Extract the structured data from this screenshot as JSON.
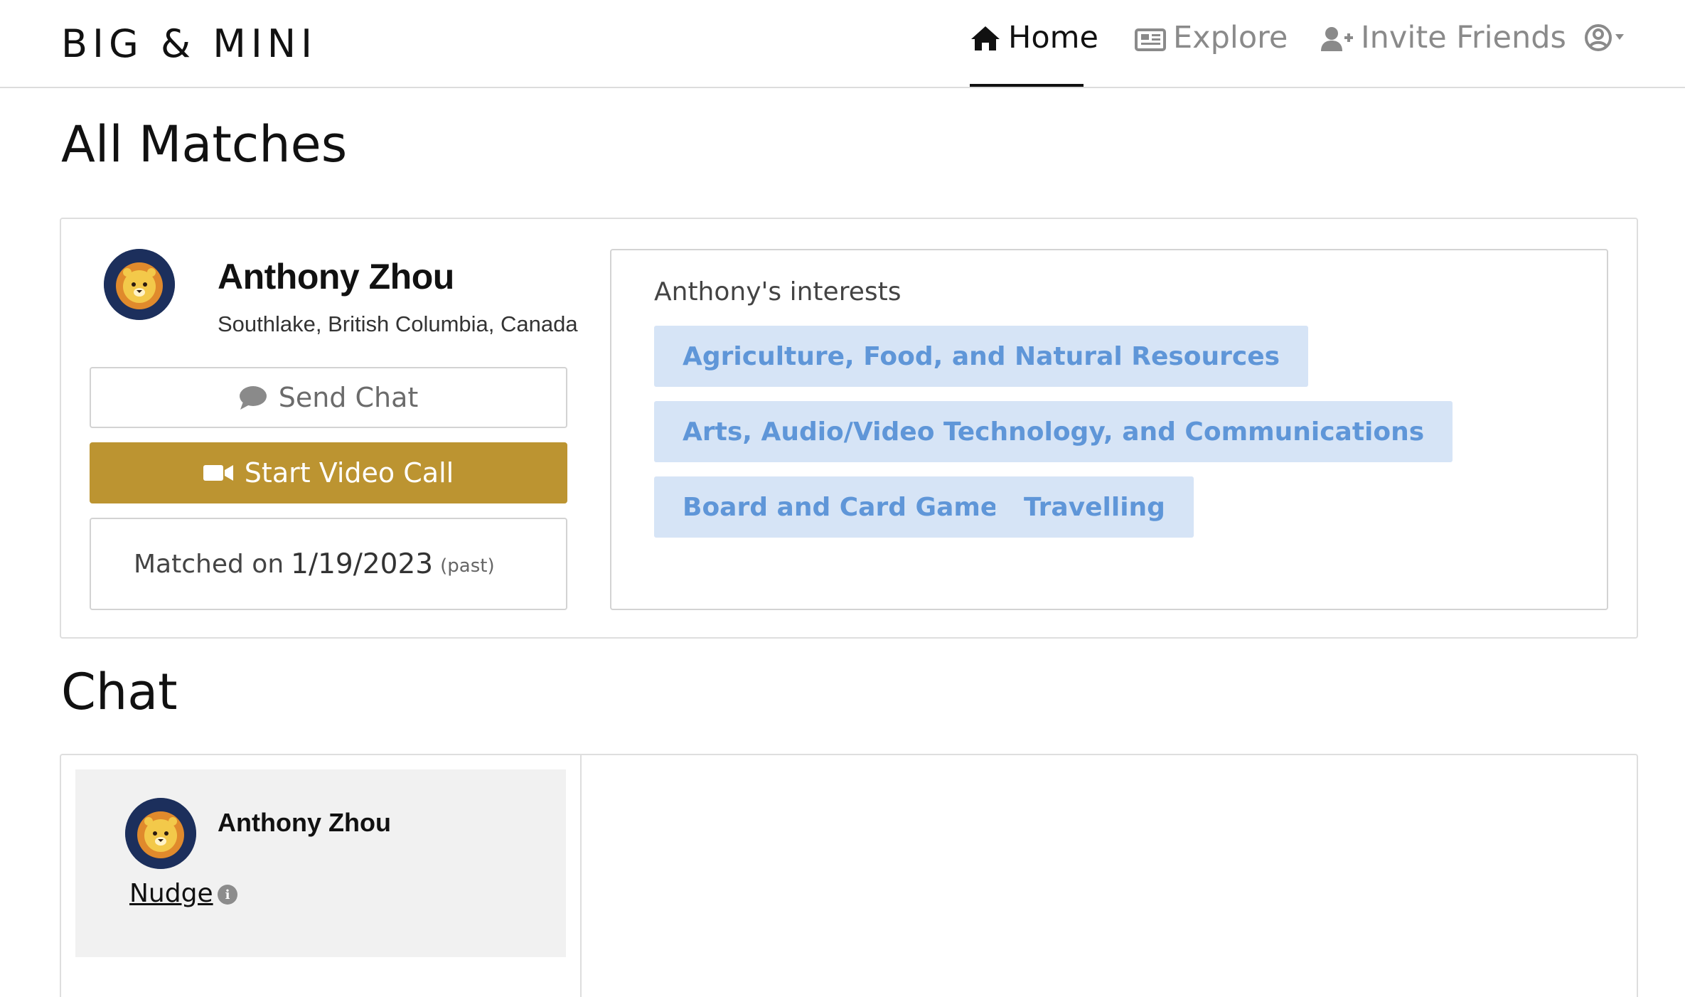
{
  "brand": "BIG & MINI",
  "nav": {
    "home": "Home",
    "explore": "Explore",
    "invite": "Invite Friends",
    "account_icon": "user-circle-icon"
  },
  "sections": {
    "matches_title": "All Matches",
    "chat_title": "Chat"
  },
  "match": {
    "name": "Anthony Zhou",
    "location": "Southlake, British Columbia, Canada",
    "send_chat": "Send Chat",
    "video_call": "Start Video Call",
    "matched_prefix": "Matched on",
    "matched_date": "1/19/2023",
    "matched_status": "(past)",
    "interests_title": "Anthony's interests",
    "interests": [
      "Agriculture, Food, and Natural Resources",
      "Arts, Audio/Video Technology, and Communications",
      "Board and Card Games",
      "Travelling"
    ]
  },
  "chat": {
    "contact_name": "Anthony Zhou",
    "nudge": "Nudge",
    "info": "i"
  },
  "colors": {
    "accent_gold": "#bc9431",
    "tag_bg": "#d6e4f6",
    "tag_text": "#5f96d8",
    "avatar_bg": "#1c2f5c"
  }
}
